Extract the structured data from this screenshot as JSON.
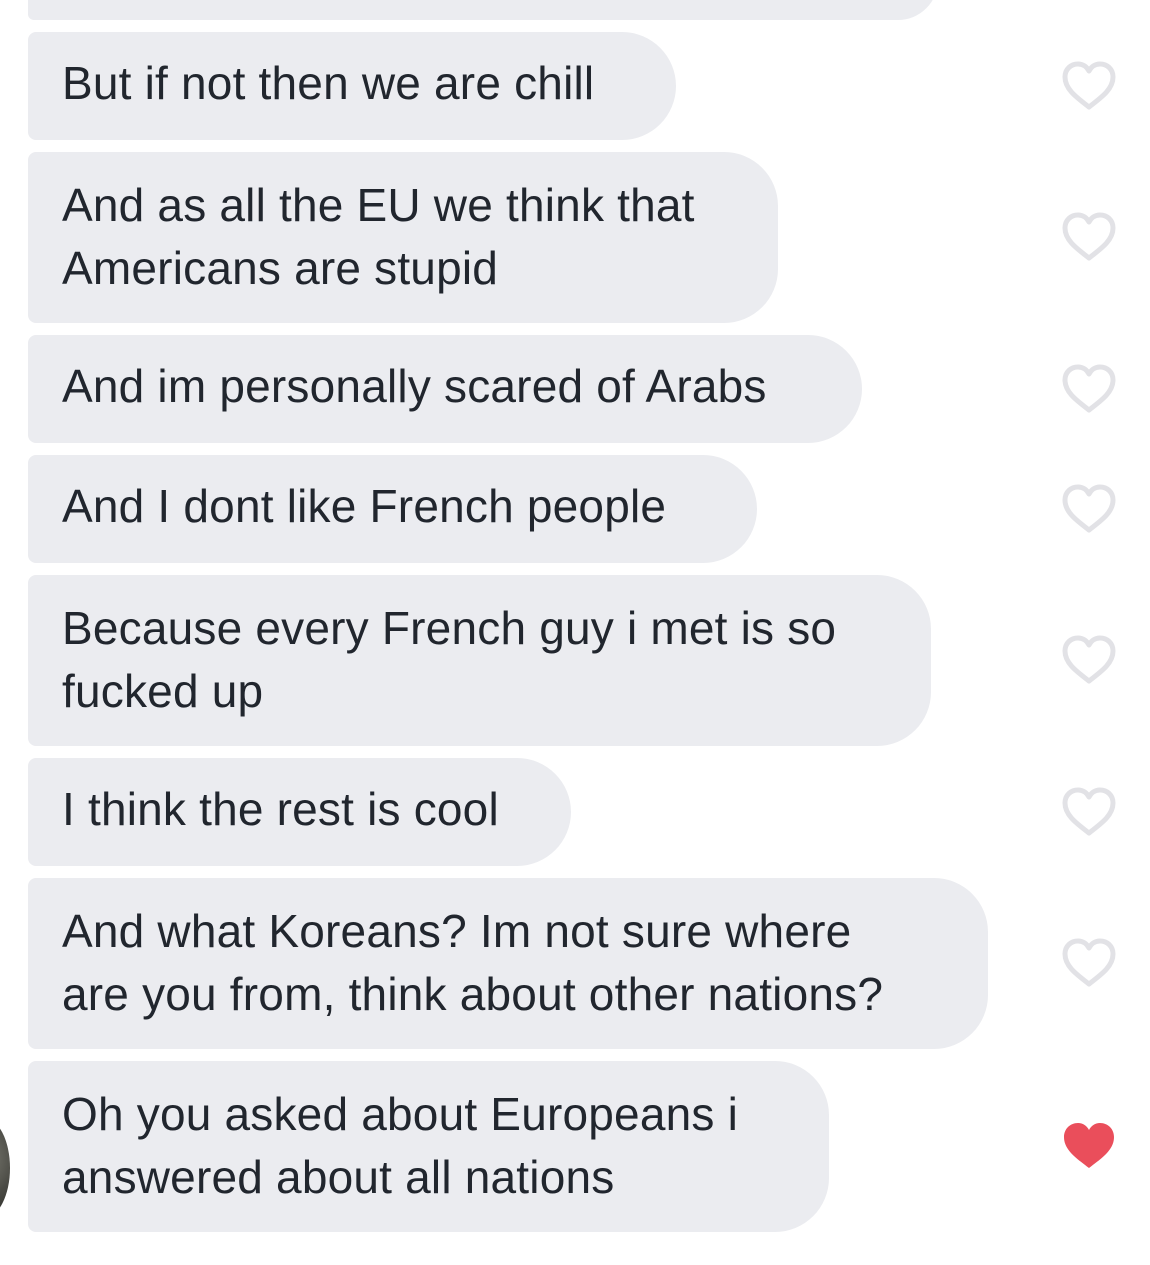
{
  "conversation": {
    "messages": [
      {
        "lines": [
          "But if not then we are chill"
        ],
        "liked": false
      },
      {
        "lines": [
          "And as all the EU we think that",
          "Americans are stupid"
        ],
        "liked": false
      },
      {
        "lines": [
          "And im personally scared of Arabs"
        ],
        "liked": false
      },
      {
        "lines": [
          "And I dont like French people"
        ],
        "liked": false
      },
      {
        "lines": [
          "Because every French guy i met is so",
          "fucked up"
        ],
        "liked": false
      },
      {
        "lines": [
          "I think the rest is cool"
        ],
        "liked": false
      },
      {
        "lines": [
          "And what Koreans? Im not sure where",
          "are you from, think about other nations?"
        ],
        "liked": false
      },
      {
        "lines": [
          "Oh you asked about Europeans i",
          "answered about all nations"
        ],
        "liked": true
      }
    ]
  },
  "colors": {
    "bubble_background": "#ebecf0",
    "text": "#21262e",
    "heart_outline": "#e2e2e6",
    "heart_liked": "#ea4e5b"
  },
  "icons": {
    "like": "heart-outline-icon",
    "liked": "heart-filled-icon"
  }
}
